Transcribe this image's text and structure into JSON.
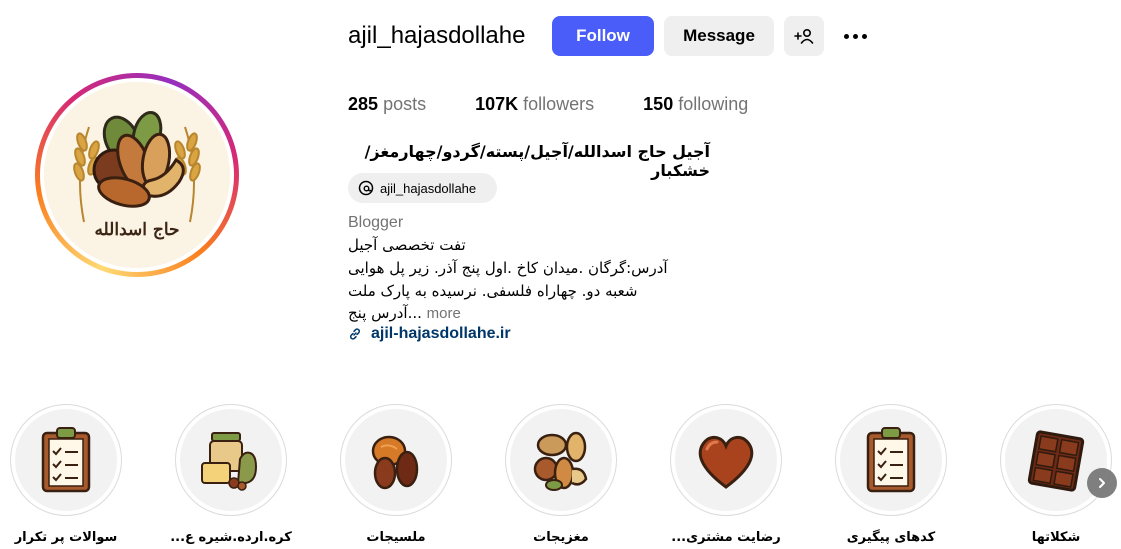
{
  "profile": {
    "username": "ajil_hajasdollahe",
    "avatar_text": "حاج اسدالله",
    "full_name": "آجیل حاج اسدالله/آجیل/پسته/گردو/چهارمغز/خشکبار",
    "threads_handle": "ajil_hajasdollahe",
    "category": "Blogger",
    "bio_lines": [
      "تفت تخصصی آجیل",
      "آدرس:گرگان .میدان کاخ .اول پنج آذر. زیر پل هوایی",
      "شعبه دو. چهاراه فلسفی. نرسیده به پارک ملت"
    ],
    "bio_truncated": "آدرس پنج...",
    "more_label": "more",
    "website": "ajil-hajasdollahe.ir"
  },
  "actions": {
    "follow_label": "Follow",
    "message_label": "Message"
  },
  "stats": {
    "posts_count": "285",
    "posts_label": "posts",
    "followers_count": "107K",
    "followers_label": "followers",
    "following_count": "150",
    "following_label": "following"
  },
  "highlights": [
    {
      "label": "سوالات پر تکرار",
      "icon": "clipboard-checklist-icon"
    },
    {
      "label": "کره.ارده.شیره ع...",
      "icon": "jars-icon"
    },
    {
      "label": "ملسیجات",
      "icon": "dried-fruit-icon"
    },
    {
      "label": "مغزیجات",
      "icon": "nuts-icon"
    },
    {
      "label": "رضایت مشتری...",
      "icon": "heart-icon"
    },
    {
      "label": "کدهای پیگیری",
      "icon": "clipboard-checklist-icon"
    },
    {
      "label": "شکلاتها",
      "icon": "chocolate-icon"
    }
  ],
  "colors": {
    "follow_button": "#4a5df9",
    "secondary_button": "#efefef",
    "link": "#00376b",
    "muted_text": "#737373"
  }
}
